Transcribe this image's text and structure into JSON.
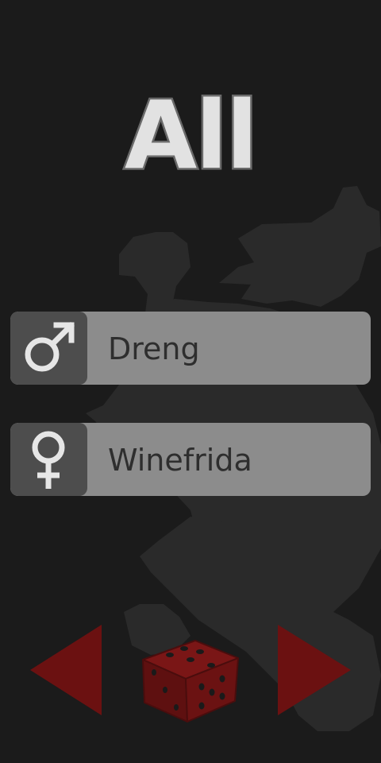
{
  "filter": {
    "title": "All"
  },
  "names": {
    "male": {
      "icon": "male-symbol-icon",
      "value": "Dreng"
    },
    "female": {
      "icon": "female-symbol-icon",
      "value": "Winefrida"
    }
  },
  "controls": {
    "previous_icon": "triangle-left-icon",
    "randomize_icon": "dice-icon",
    "next_icon": "triangle-right-icon"
  },
  "background": {
    "image": "heraldic-lion-icon"
  },
  "colors": {
    "background": "#1b1b1b",
    "row": "#8c8c8c",
    "gender_box": "#4d4d4d",
    "accent_red": "#6b1111"
  }
}
